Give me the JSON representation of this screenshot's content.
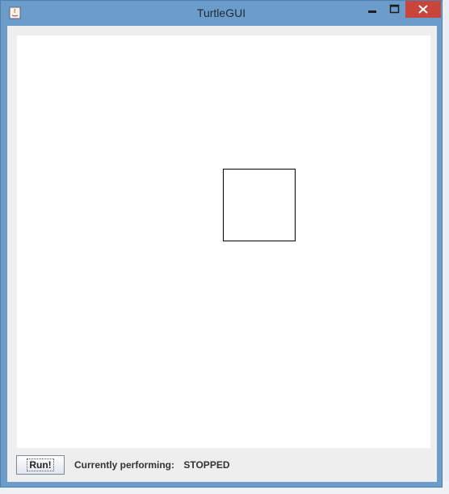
{
  "window": {
    "title": "TurtleGUI",
    "icons": [
      "java-app-icon",
      "minimize-icon",
      "maximize-icon",
      "close-icon"
    ]
  },
  "toolbar": {
    "run_label": "Run!",
    "status_label": "Currently performing:",
    "status_value": "STOPPED"
  },
  "colors": {
    "titlebar": "#6c9cc9",
    "close": "#c8453b",
    "canvas": "#ffffff",
    "panel": "#eeeeee"
  }
}
